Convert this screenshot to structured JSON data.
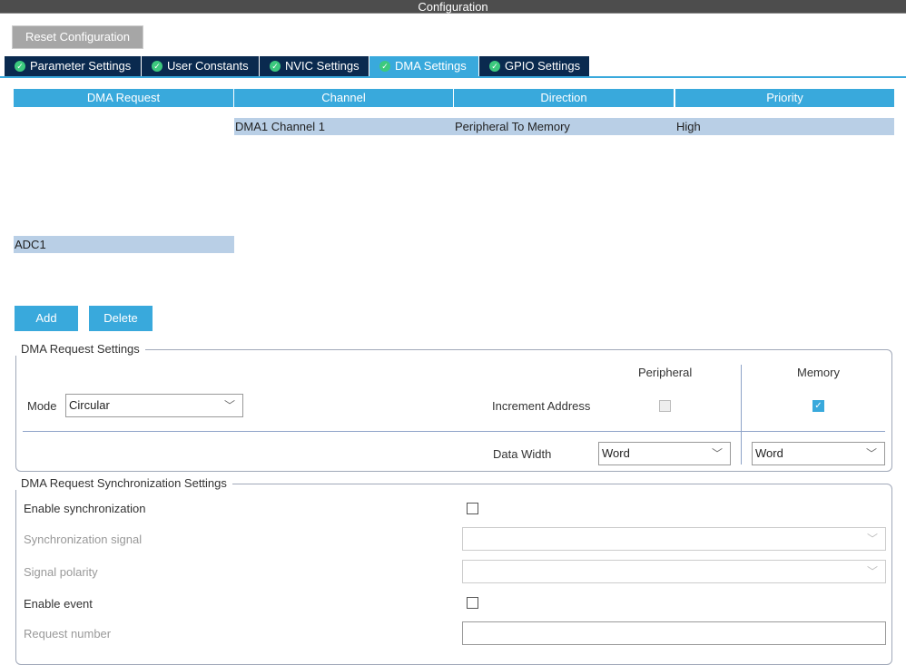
{
  "window": {
    "title": "Configuration"
  },
  "toolbar": {
    "reset_label": "Reset Configuration"
  },
  "tabs": [
    {
      "label": "Parameter Settings"
    },
    {
      "label": "User Constants"
    },
    {
      "label": "NVIC Settings"
    },
    {
      "label": "DMA Settings",
      "active": true
    },
    {
      "label": "GPIO Settings"
    }
  ],
  "table": {
    "headers": [
      "DMA Request",
      "Channel",
      "Direction",
      "Priority"
    ],
    "rows": [
      [
        "ADC1",
        "DMA1 Channel 1",
        "Peripheral To Memory",
        "High"
      ]
    ]
  },
  "buttons": {
    "add": "Add",
    "delete": "Delete"
  },
  "dma_request_settings": {
    "legend": "DMA Request Settings",
    "peripheral_header": "Peripheral",
    "memory_header": "Memory",
    "mode_label": "Mode",
    "mode_value": "Circular",
    "increment_label": "Increment Address",
    "peripheral_increment": false,
    "memory_increment": true,
    "data_width_label": "Data Width",
    "peripheral_width": "Word",
    "memory_width": "Word"
  },
  "sync_settings": {
    "legend": "DMA Request Synchronization Settings",
    "enable_sync_label": "Enable synchronization",
    "sync_signal_label": "Synchronization signal",
    "signal_polarity_label": "Signal polarity",
    "enable_event_label": "Enable event",
    "request_number_label": "Request number"
  },
  "colors": {
    "accent": "#39a9dc",
    "tab_dark": "#0a2a4f",
    "row_selected": "#b9cfe6"
  }
}
